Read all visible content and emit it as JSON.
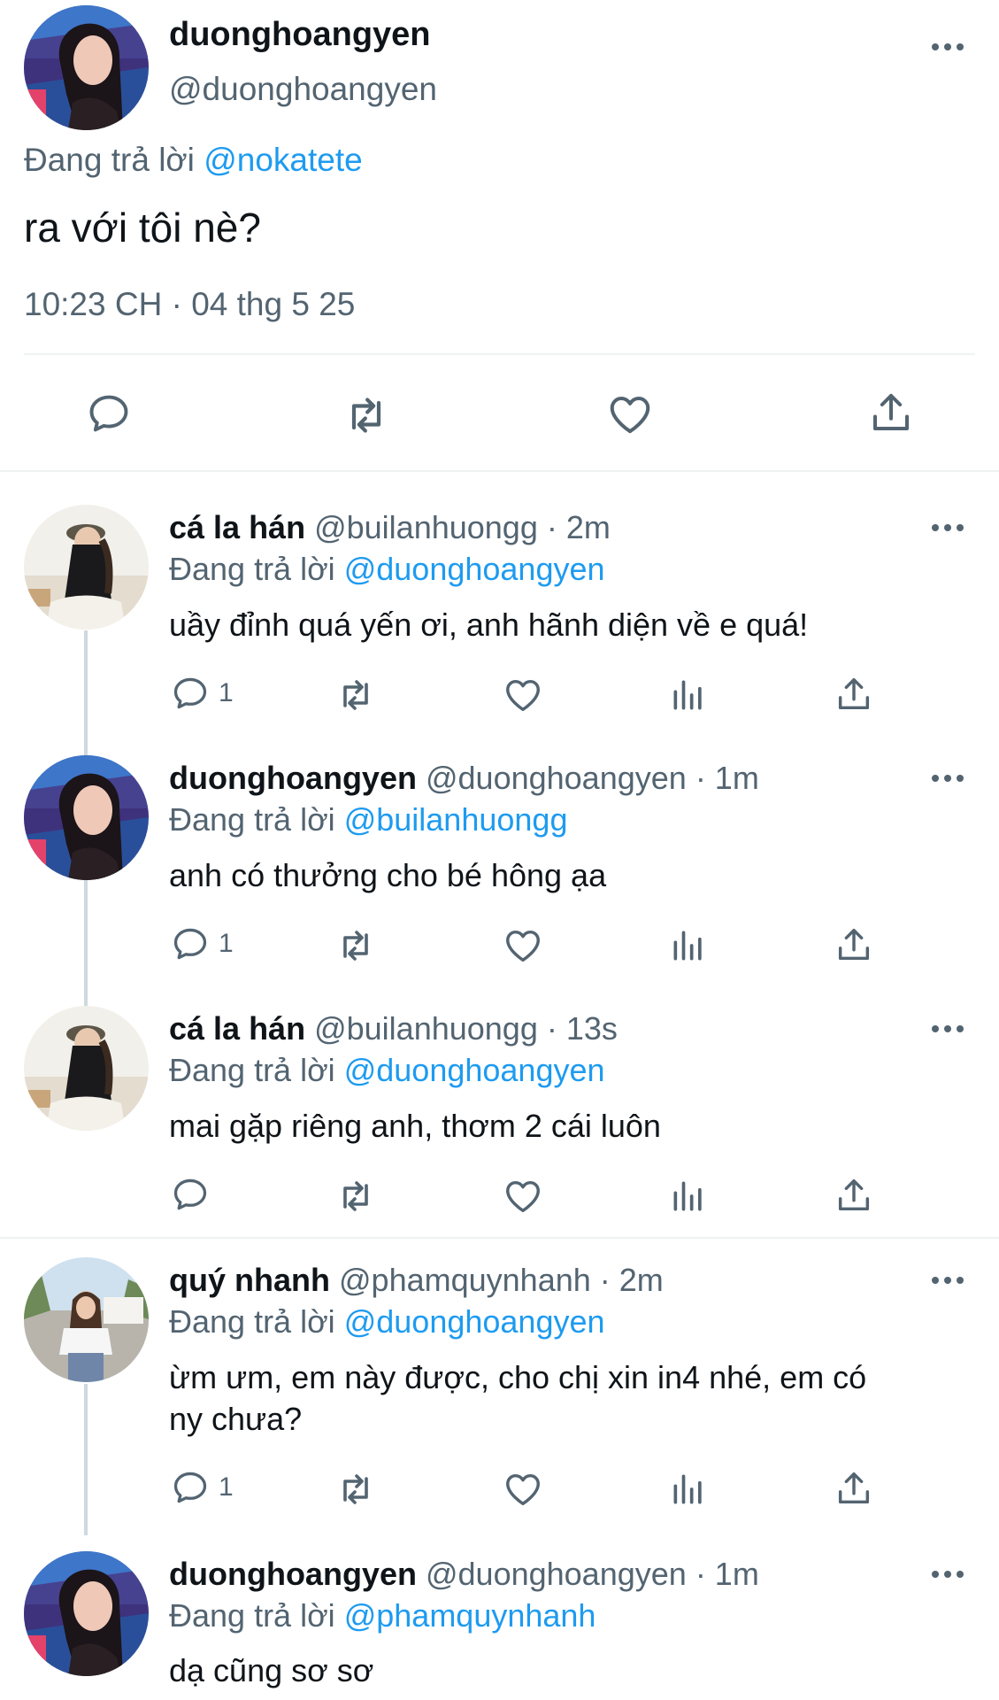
{
  "main_tweet": {
    "display_name": "duonghoangyen",
    "handle": "@duonghoangyen",
    "replying_prefix": "Đang trả lời",
    "replying_to": "@nokatete",
    "text": "ra với tôi nè?",
    "timestamp": "10:23 CH · 04 thg 5 25"
  },
  "replies": [
    {
      "display_name": "cá la hán",
      "handle": "@builanhuongg",
      "time": "· 2m",
      "replying_prefix": "Đang trả lời",
      "replying_to": "@duonghoangyen",
      "text": "uầy đỉnh quá yến ơi, anh hãnh diện về e quá!",
      "reply_count": "1"
    },
    {
      "display_name": "duonghoangyen",
      "handle": "@duonghoangyen",
      "time": "· 1m",
      "replying_prefix": "Đang trả lời",
      "replying_to": "@builanhuongg",
      "text": "anh có thưởng cho bé hông ạa",
      "reply_count": "1"
    },
    {
      "display_name": "cá la hán",
      "handle": "@builanhuongg",
      "time": "· 13s",
      "replying_prefix": "Đang trả lời",
      "replying_to": "@duonghoangyen",
      "text": "mai gặp riêng anh, thơm 2 cái luôn",
      "reply_count": ""
    },
    {
      "display_name": "quý nhanh",
      "handle": "@phamquynhanh",
      "time": "· 2m",
      "replying_prefix": "Đang trả lời",
      "replying_to": "@duonghoangyen",
      "text_line1": "ừm ưm, em này được, cho chị xin in4 nhé, em có",
      "text_line2": "ny chưa?",
      "reply_count": "1"
    },
    {
      "display_name": "duonghoangyen",
      "handle": "@duonghoangyen",
      "time": "· 1m",
      "replying_prefix": "Đang trả lời",
      "replying_to": "@phamquynhanh",
      "text": "dạ cũng sơ sơ"
    }
  ],
  "colors": {
    "accent": "#1d9bf0",
    "secondary_text": "#536471",
    "divider": "#eff3f4"
  },
  "icons": [
    "reply-icon",
    "retweet-icon",
    "like-icon",
    "views-icon",
    "share-icon",
    "more-icon"
  ]
}
